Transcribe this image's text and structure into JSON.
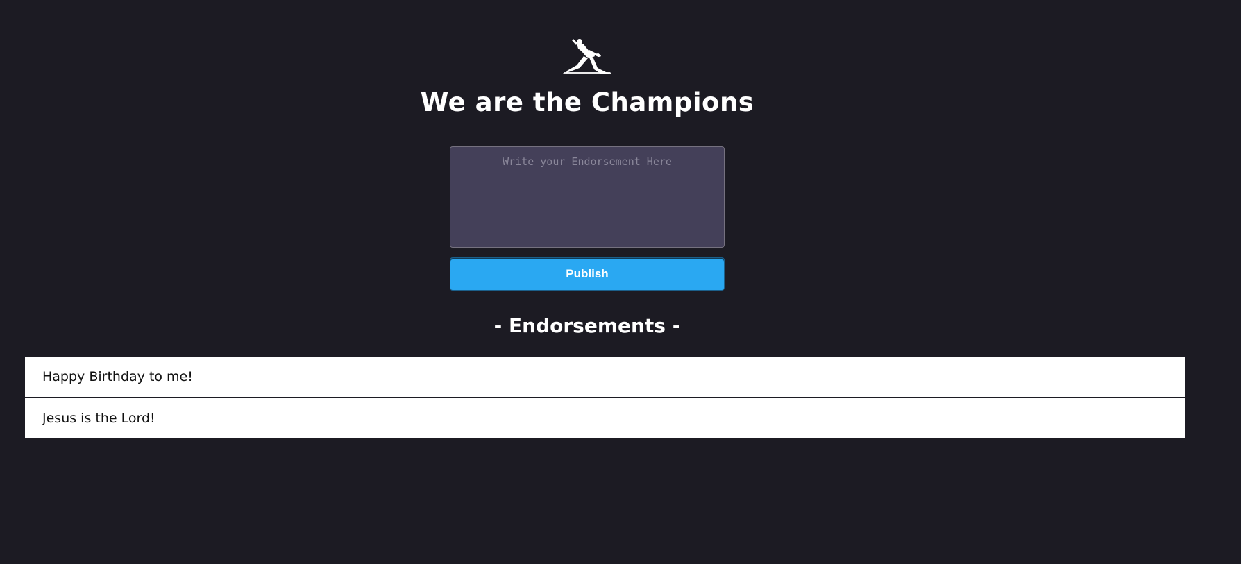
{
  "header": {
    "logo_icon": "freddie-mercury-silhouette-icon",
    "title": "We are the Champions"
  },
  "form": {
    "placeholder": "Write your Endorsement Here",
    "value": "",
    "publish_label": "Publish"
  },
  "endorsements": {
    "heading": "- Endorsements -",
    "items": [
      {
        "text": "Happy Birthday to me!"
      },
      {
        "text": "Jesus is the Lord!"
      }
    ]
  },
  "colors": {
    "background": "#1c1b23",
    "input_background": "#444059",
    "button": "#2aa8f2",
    "item_background": "#ffffff"
  }
}
